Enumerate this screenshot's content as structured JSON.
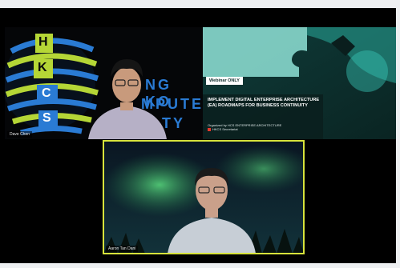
{
  "participants": {
    "top_left": {
      "name": "Dave Chen"
    },
    "top_right": {
      "badge": "Webinar ONLY",
      "title": "IMPLEMENT DIGITAL ENTERPRISE ARCHITECTURE (EA) ROADMAPS FOR BUSINESS CONTINUITY",
      "org_line1": "Organized by HCS ENTERPRISE ARCHITECTURE",
      "org_line2": "HKCS Secretariat"
    },
    "bottom": {
      "name": "Aaron Tan Dani"
    }
  },
  "background_logo": {
    "letters": [
      "H",
      "K",
      "C",
      "S"
    ],
    "text_line1": "NG KO",
    "text_line2": "MPUTE",
    "text_line3": "TY"
  },
  "colors": {
    "active_speaker_border": "#d7e33b",
    "logo_green": "#b5d636",
    "logo_blue": "#2a7bd4"
  }
}
